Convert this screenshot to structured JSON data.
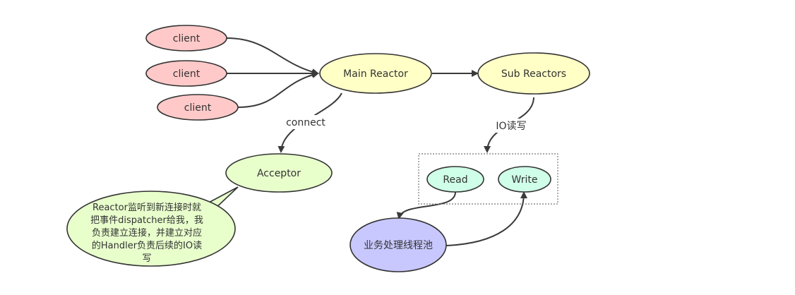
{
  "nodes": {
    "client_1": {
      "label": "client",
      "fill": "#ffc9c9"
    },
    "client_2": {
      "label": "client",
      "fill": "#ffc9c9"
    },
    "client_3": {
      "label": "client",
      "fill": "#ffc9c9"
    },
    "main_reactor": {
      "label": "Main Reactor",
      "fill": "#ffffc6"
    },
    "sub_reactors": {
      "label": "Sub Reactors",
      "fill": "#ffffc6"
    },
    "acceptor": {
      "label": "Acceptor",
      "fill": "#e8ffcc"
    },
    "read": {
      "label": "Read",
      "fill": "#cfffe8"
    },
    "write": {
      "label": "Write",
      "fill": "#cfffe8"
    },
    "thread_pool": {
      "label": "业务处理线程池",
      "fill": "#c8c8ff"
    }
  },
  "edge_labels": {
    "connect": "connect",
    "io_rw": "IO读写"
  },
  "callout": {
    "fill": "#e8ffcc",
    "lines": [
      "Reactor监听到新连接时就",
      "把事件dispatcher给我，我",
      "负责建立连接，并建立对应",
      "的Handler负责后续的IO读",
      "写"
    ]
  }
}
